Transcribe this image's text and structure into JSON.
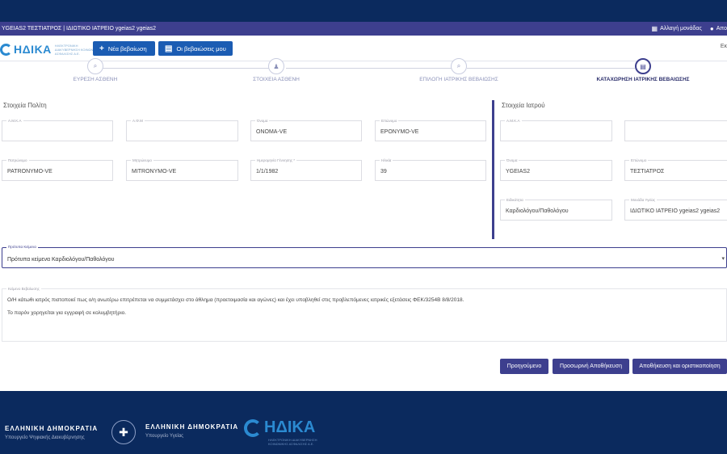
{
  "userbar": {
    "left_text": "YGEIAS2 ΤΕΣΤΙΑΤΡΟΣ | ΙΔΙΩΤΙΚΟ ΙΑΤΡΕΙΟ ygeias2 ygeias2",
    "change_unit_label": "Αλλαγή μονάδας",
    "logout_label": "Απο"
  },
  "header": {
    "logo_text": "ΗΔΙΚΑ",
    "logo_tagline": "ΗΛΕΚΤΡΟΝΙΚΗ ΔΙΑΚΥΒΕΡΝΗΣΗ ΚΟΙΝΩΝΙΚΗΣ ΑΣΦΑΛΙΣΗΣ Α.Ε.",
    "new_cert_label": "Νέα βεβαίωση",
    "my_certs_label": "Οι βεβαιώσεις μου",
    "right_text": "Εκ"
  },
  "stepper": {
    "steps": [
      {
        "label": "ΕΥΡΕΣΗ ΑΣΘΕΝΗ",
        "icon": "search-icon"
      },
      {
        "label": "ΣΤΟΙΧΕΙΑ ΑΣΘΕΝΗ",
        "icon": "person-icon"
      },
      {
        "label": "ΕΠΙΛΟΓΗ ΙΑΤΡΙΚΗΣ ΒΕΒΑΙΩΣΗΣ",
        "icon": "search-icon"
      },
      {
        "label": "ΚΑΤΑΧΩΡΗΣΗ ΙΑΤΡΙΚΗΣ ΒΕΒΑΙΩΣΗΣ",
        "icon": "document-icon"
      }
    ],
    "active_index": 3
  },
  "citizen": {
    "title": "Στοιχεία Πολίτη",
    "amka": {
      "label": "Α.Μ.Κ.Α",
      "value": ""
    },
    "afm": {
      "label": "Α.Φ.Μ",
      "value": ""
    },
    "first_name": {
      "label": "Όνομα",
      "value": "ONOMA-VE"
    },
    "last_name": {
      "label": "Επώνυμο",
      "value": "EPONYMO-VE"
    },
    "father_name": {
      "label": "Πατρώνυμο",
      "value": "PATRONYMO-VE"
    },
    "mother_name": {
      "label": "Μητρώνυμο",
      "value": "MITRONYMO-VE"
    },
    "birth_date": {
      "label": "Ημερομηνία Γέννησης *",
      "value": "1/1/1982"
    },
    "age": {
      "label": "Ηλικία",
      "value": "39"
    }
  },
  "doctor": {
    "title": "Στοιχεία Ιατρού",
    "amka": {
      "label": "Α.Μ.Κ.Α",
      "value": ""
    },
    "extra": {
      "label": "",
      "value": ""
    },
    "first_name": {
      "label": "Όνομα",
      "value": "YGEIAS2"
    },
    "last_name": {
      "label": "Επώνυμο",
      "value": "ΤΕΣΤΙΑΤΡΟΣ"
    },
    "specialty": {
      "label": "Ειδικότητα",
      "value": "Καρδιολόγου/Παθολόγου"
    },
    "health_unit": {
      "label": "Μονάδα Υγείας",
      "value": "ΙΔΙΩΤΙΚΟ ΙΑΤΡΕΙΟ ygeias2 ygeias2"
    }
  },
  "template_select": {
    "label": "Πρότυπα Κείμενα",
    "value": "Πρότυπα κείμενα Καρδιολόγου/Παθολόγου",
    "caret": "▾"
  },
  "certificate_text": {
    "label": "Κείμενο Βεβαίωσης",
    "line1": "Ο/Η κάτωθι ιατρός πιστοποιεί πως ο/η ανωτέρω επιτρέπεται να συμμετάσχει στο άθλημα (προετοιμασία και αγώνες) και έχει υποβληθεί στις προβλεπόμενες ιατρικές εξετάσεις ΦΕΚ/3254Β 8/8/2018.",
    "line2": "Το παρόν χορηγείται για εγγραφή σε κολυμβητήριο."
  },
  "actions": {
    "previous_label": "Προηγούμενο",
    "temp_save_label": "Προσωρινή Αποθήκευση",
    "final_save_label": "Αποθήκευση και οριστικοποίηση"
  },
  "footer": {
    "republic_title": "ΕΛΛΗΝΙΚΗ ΔΗΜΟΚΡΑΤΙΑ",
    "republic_sub": "Υπουργείο Ψηφιακής Διακυβέρνησης",
    "republic2_title": "ΕΛΛΗΝΙΚΗ ΔΗΜΟΚΡΑΤΙΑ",
    "republic2_sub": "Υπουργείο Υγείας",
    "logo_text": "ΗΔΙΚΑ",
    "logo_tagline": "ΗΛΕΚΤΡΟΝΙΚΗ ΔΙΑΚΥΒΕΡΝΗΣΗ ΚΟΙΝΩΝΙΚΗΣ ΑΣΦΑΛΙΣΗΣ Α.Ε."
  },
  "colors": {
    "navy": "#0b2a5e",
    "purple": "#3d3f8e",
    "blue_button": "#1b5cb3",
    "logo_blue": "#2b8ad1"
  }
}
